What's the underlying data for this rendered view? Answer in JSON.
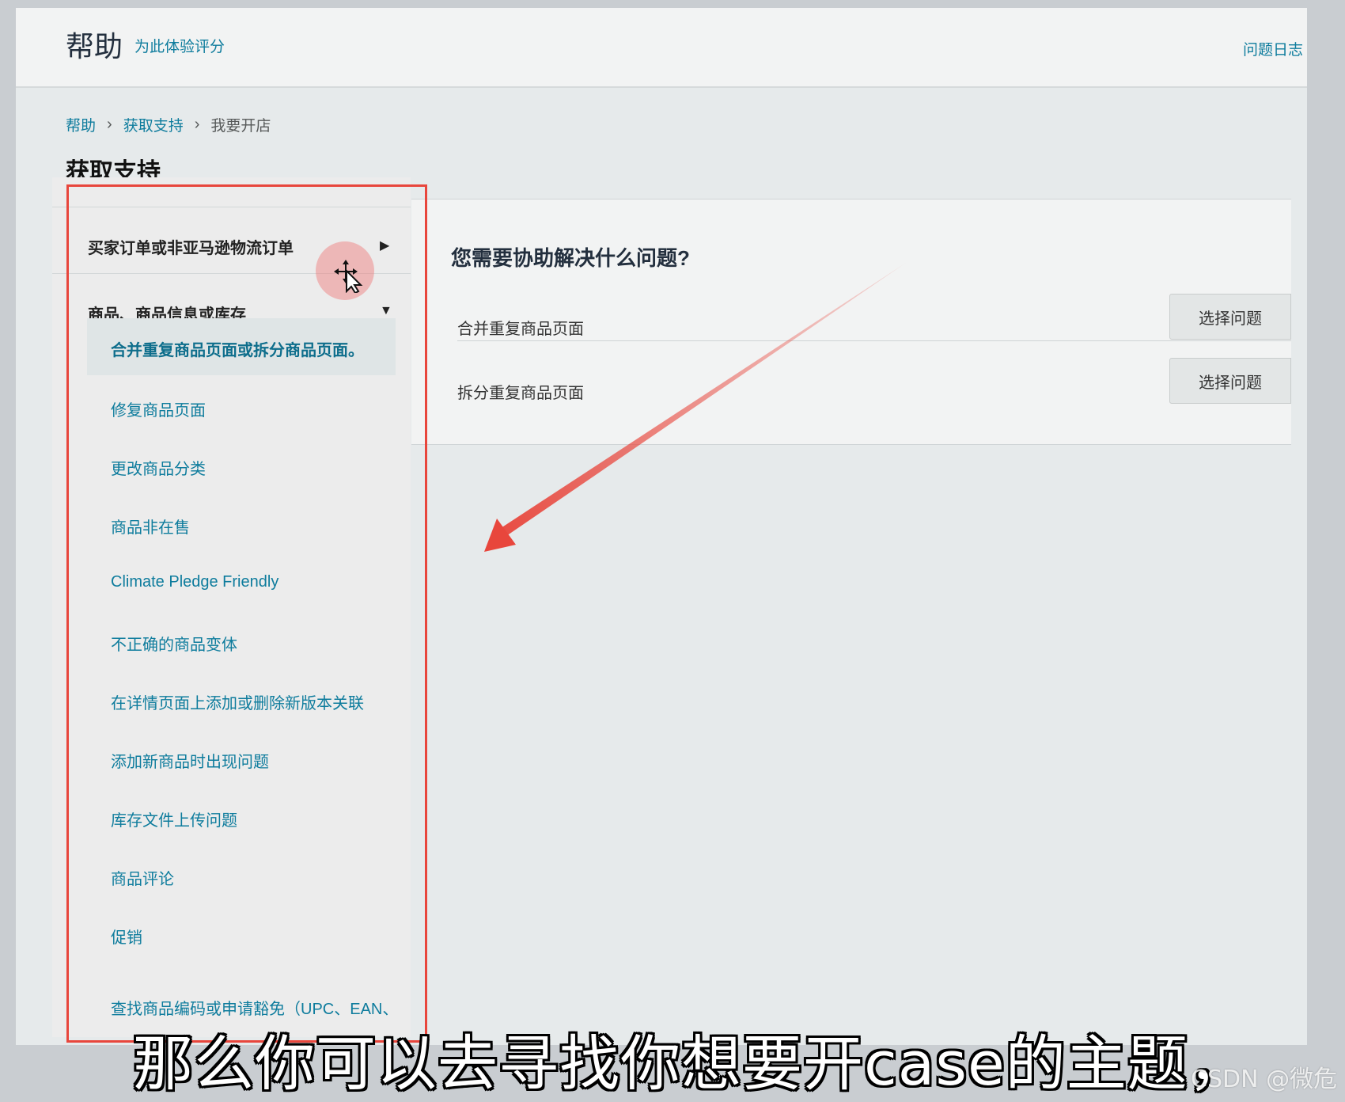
{
  "header": {
    "title": "帮助",
    "rate_link": "为此体验评分",
    "issue_log_link": "问题日志"
  },
  "breadcrumb": [
    {
      "label": "帮助"
    },
    {
      "label": "获取支持"
    },
    {
      "label": "我要开店"
    }
  ],
  "page_title": "获取支持",
  "sidebar": {
    "categories": [
      {
        "label": "买家订单或非亚马逊物流订单",
        "state": "collapsed"
      },
      {
        "label": "商品、商品信息或库存",
        "state": "expanded"
      }
    ],
    "items": [
      {
        "label": "合并重复商品页面或拆分商品页面。",
        "selected": true
      },
      {
        "label": "修复商品页面"
      },
      {
        "label": "更改商品分类"
      },
      {
        "label": "商品非在售"
      },
      {
        "label": "Climate Pledge Friendly"
      },
      {
        "label": "不正确的商品变体"
      },
      {
        "label": "在详情页面上添加或删除新版本关联"
      },
      {
        "label": "添加新商品时出现问题"
      },
      {
        "label": "库存文件上传问题"
      },
      {
        "label": "商品评论"
      },
      {
        "label": "促销"
      },
      {
        "label": "查找商品编码或申请豁免（UPC、EAN、"
      }
    ]
  },
  "main": {
    "question": "您需要协助解决什么问题?",
    "options": [
      {
        "label": "合并重复商品页面",
        "button": "选择问题"
      },
      {
        "label": "拆分重复商品页面",
        "button": "选择问题"
      }
    ]
  },
  "overlay": {
    "subtitle": "那么你可以去寻找你想要开case的主题，",
    "watermark": "CSDN @微危"
  },
  "colors": {
    "link": "#0e7c9d",
    "annotation_red": "#e8463c",
    "panel_bg": "#f2f3f3"
  }
}
